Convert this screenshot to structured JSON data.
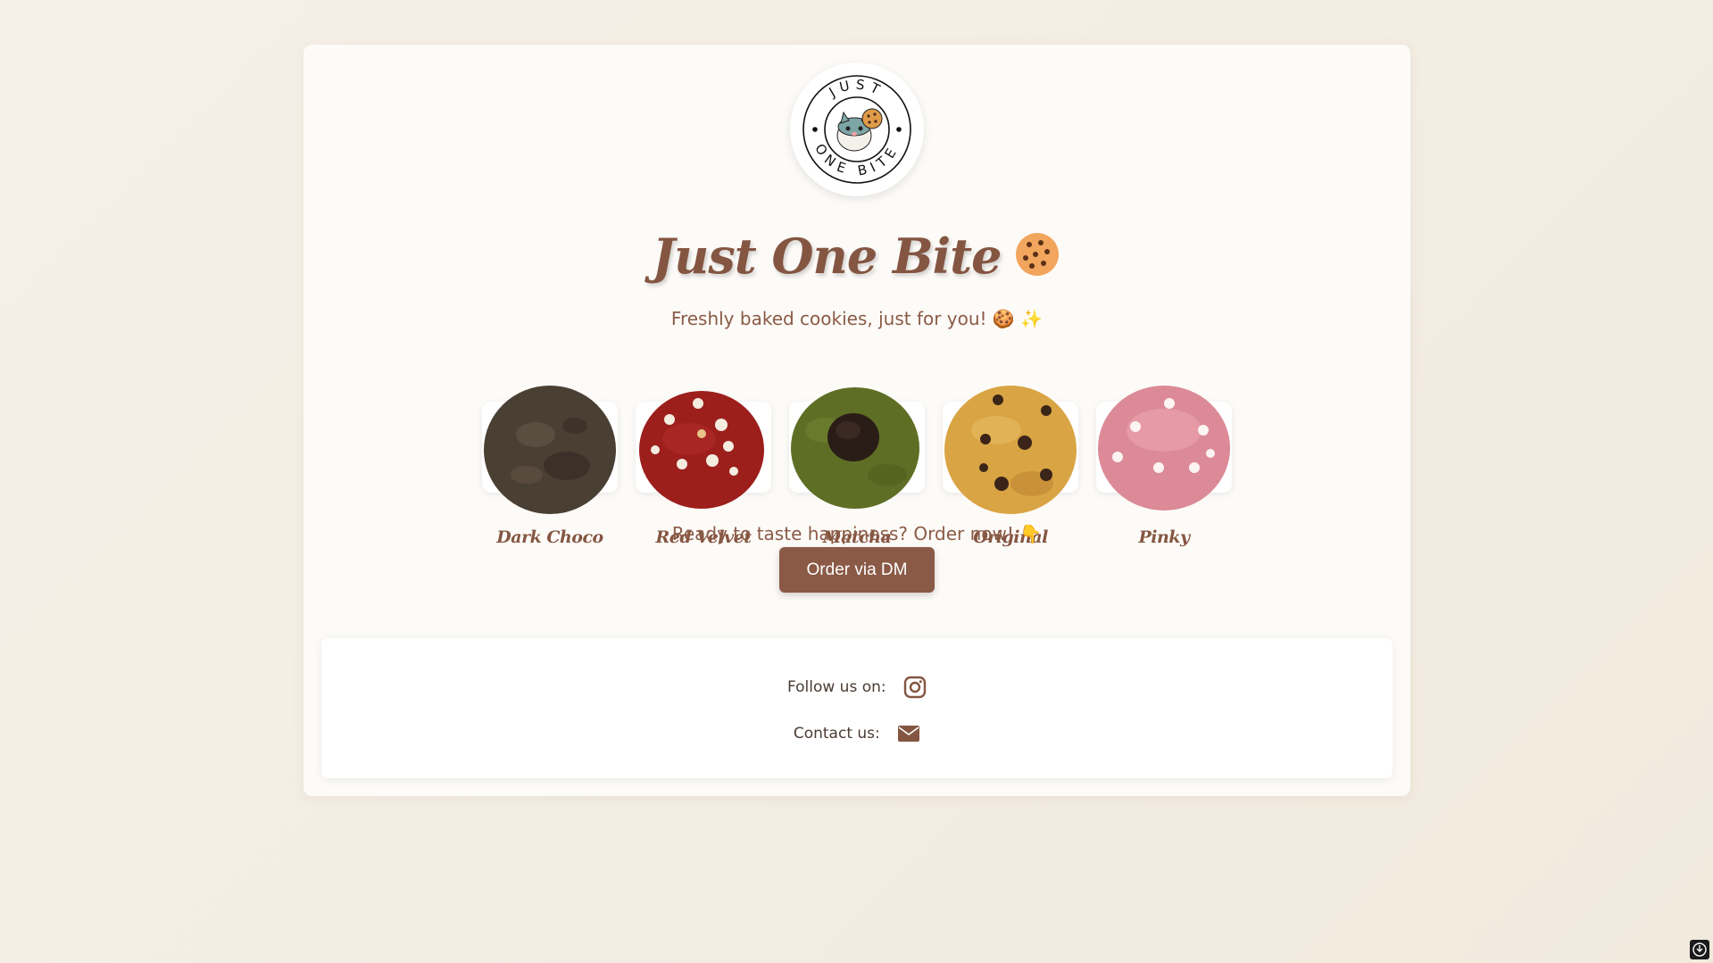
{
  "brand": {
    "title": "Just One Bite",
    "title_emoji": "🍪",
    "logo_top_text": "JUST",
    "logo_bottom_text": "ONE BITE",
    "subtitle": "Freshly baked cookies, just for you! 🍪 ✨"
  },
  "cookies": [
    {
      "name": "Dark Choco",
      "color": "#4a3f33",
      "topping": "none"
    },
    {
      "name": "Red Velvet",
      "color": "#9c1f1c",
      "topping": "white chips"
    },
    {
      "name": "Matcha",
      "color": "#5f6e25",
      "topping": "chocolate chunk"
    },
    {
      "name": "Original",
      "color": "#d9a443",
      "topping": "chocolate chips"
    },
    {
      "name": "Pinky",
      "color": "#dc8a97",
      "topping": "white chips"
    }
  ],
  "cta": {
    "text": "Ready to taste happiness? Order now! 👇",
    "button_label": "Order via DM"
  },
  "footer": {
    "follow_label": "Follow us on:",
    "follow_icon": "instagram-icon",
    "contact_label": "Contact us:",
    "contact_icon": "envelope-icon"
  },
  "colors": {
    "accent": "#8a5a46",
    "background": "#f3ede2",
    "card": "#fdfbf8"
  }
}
